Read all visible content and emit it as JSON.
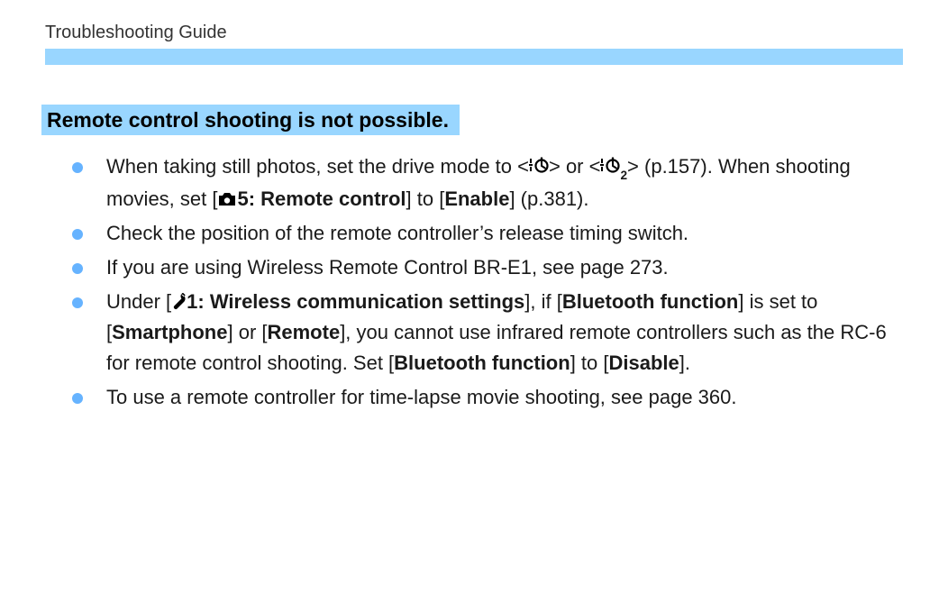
{
  "header": {
    "title": "Troubleshooting Guide"
  },
  "section": {
    "heading": "Remote control shooting is not possible."
  },
  "bullets": {
    "b1": {
      "t1": "When taking still photos, set the drive mode to <",
      "t2": "> or <",
      "t3": "> (p.157). When shooting movies, set [",
      "menu1": "5: Remote control",
      "t4": "] to [",
      "enable": "Enable",
      "t5": "] (p.381)."
    },
    "b2": {
      "text": "Check the position of the remote controller’s release timing switch."
    },
    "b3": {
      "text": "If you are using Wireless Remote Control BR-E1, see page 273."
    },
    "b4": {
      "t1": "Under [",
      "menu2": "1: Wireless communication settings",
      "t2": "], if [",
      "bt_func1": "Bluetooth function",
      "t3": "] is set to [",
      "smartphone": "Smartphone",
      "t4": "] or [",
      "remote": "Remote",
      "t5": "], you cannot use infrared remote controllers such as the RC-6 for remote control shooting. Set [",
      "bt_func2": "Bluetooth function",
      "t6": "] to [",
      "disable": "Disable",
      "t7": "]."
    },
    "b5": {
      "text": "To use a remote controller for time-lapse movie shooting, see page 360."
    }
  }
}
